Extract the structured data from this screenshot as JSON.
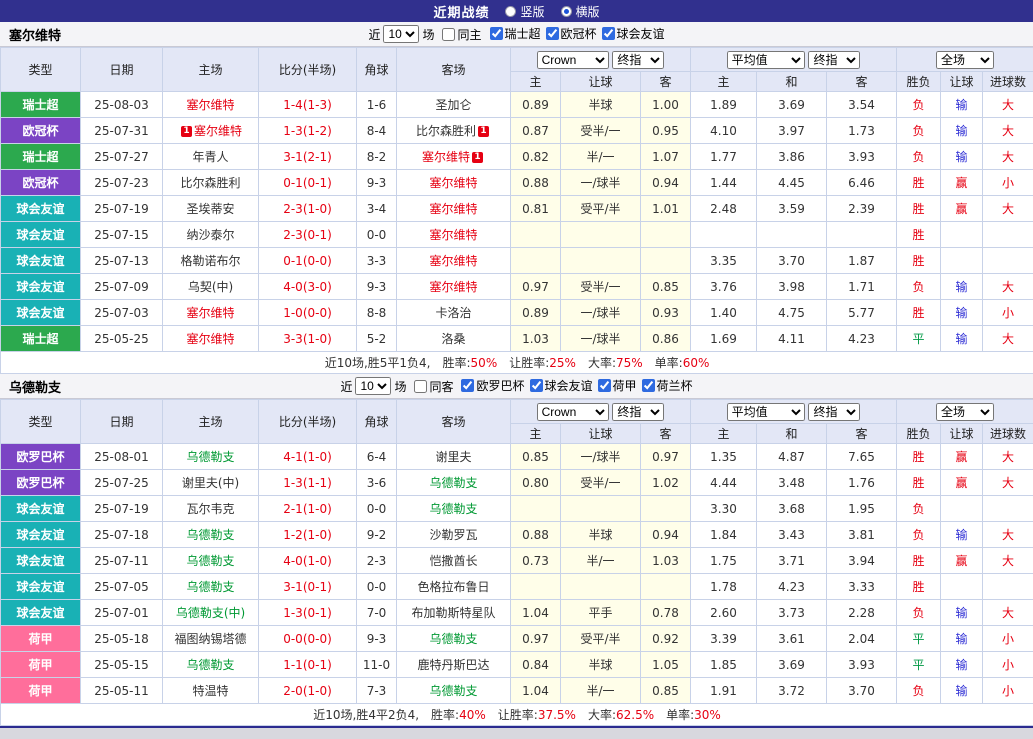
{
  "topbar": {
    "title": "近期战绩",
    "radio_vertical": "竖版",
    "radio_horizontal": "横版",
    "selected": "横版"
  },
  "header": {
    "col_type": "类型",
    "col_date": "日期",
    "col_home": "主场",
    "col_score": "比分(半场)",
    "col_corner": "角球",
    "col_away": "客场",
    "bookmaker_select": "Crown",
    "final_select": "终指",
    "avg_select": "平均值",
    "avg_final_select": "终指",
    "fullmatch_select": "全场",
    "sub_home": "主",
    "sub_handicap": "让球",
    "sub_away": "客",
    "sub_avg_home": "主",
    "sub_draw": "和",
    "sub_avg_away": "客",
    "sub_result": "胜负",
    "sub_result_handicap": "让球",
    "sub_goals": "进球数"
  },
  "filter_common": {
    "prefix": "近",
    "count": "10",
    "suffix": "场"
  },
  "colors": {
    "types": {
      "瑞士超": "#2CA94E",
      "欧冠杯": "#7B44C4",
      "球会友谊": "#19B1B5",
      "欧罗巴杯": "#7B44C4",
      "荷甲": "#FF6E9B"
    },
    "results": {
      "胜": "#E60012",
      "平": "#009944",
      "负": "#E60012",
      "赢": "#E60012",
      "输": "#2C2CD4",
      "大": "#E60012",
      "小": "#E60012"
    }
  },
  "sections": [
    {
      "team": "塞尔维特",
      "team_color": "#E60012",
      "filter": {
        "same_label": "同主",
        "same_checked": false,
        "leagues": [
          {
            "label": "瑞士超",
            "checked": true
          },
          {
            "label": "欧冠杯",
            "checked": true
          },
          {
            "label": "球会友谊",
            "checked": true
          }
        ]
      },
      "rows": [
        {
          "type": "瑞士超",
          "date": "25-08-03",
          "home": "塞尔维特",
          "home_focus": true,
          "score": "1-4(1-3)",
          "corner": "1-6",
          "away": "圣加仑",
          "odds": [
            "0.89",
            "半球",
            "1.00"
          ],
          "avg": [
            "1.89",
            "3.69",
            "3.54"
          ],
          "result": [
            "负",
            "输",
            "大"
          ]
        },
        {
          "type": "欧冠杯",
          "date": "25-07-31",
          "home": "塞尔维特",
          "home_focus": true,
          "home_card": "1",
          "score": "1-3(1-2)",
          "corner": "8-4",
          "away": "比尔森胜利",
          "away_card": "1",
          "odds": [
            "0.87",
            "受半/一",
            "0.95"
          ],
          "avg": [
            "4.10",
            "3.97",
            "1.73"
          ],
          "result": [
            "负",
            "输",
            "大"
          ]
        },
        {
          "type": "瑞士超",
          "date": "25-07-27",
          "home": "年青人",
          "score": "3-1(2-1)",
          "corner": "8-2",
          "away": "塞尔维特",
          "away_focus": true,
          "away_card": "1",
          "odds": [
            "0.82",
            "半/一",
            "1.07"
          ],
          "avg": [
            "1.77",
            "3.86",
            "3.93"
          ],
          "result": [
            "负",
            "输",
            "大"
          ]
        },
        {
          "type": "欧冠杯",
          "date": "25-07-23",
          "home": "比尔森胜利",
          "score": "0-1(0-1)",
          "corner": "9-3",
          "away": "塞尔维特",
          "away_focus": true,
          "odds": [
            "0.88",
            "一/球半",
            "0.94"
          ],
          "avg": [
            "1.44",
            "4.45",
            "6.46"
          ],
          "result": [
            "胜",
            "赢",
            "小"
          ]
        },
        {
          "type": "球会友谊",
          "date": "25-07-19",
          "home": "圣埃蒂安",
          "score": "2-3(1-0)",
          "corner": "3-4",
          "away": "塞尔维特",
          "away_focus": true,
          "odds": [
            "0.81",
            "受平/半",
            "1.01"
          ],
          "avg": [
            "2.48",
            "3.59",
            "2.39"
          ],
          "result": [
            "胜",
            "赢",
            "大"
          ]
        },
        {
          "type": "球会友谊",
          "date": "25-07-15",
          "home": "纳沙泰尔",
          "score": "2-3(0-1)",
          "corner": "0-0",
          "away": "塞尔维特",
          "away_focus": true,
          "odds": [
            "",
            "",
            ""
          ],
          "avg": [
            "",
            "",
            ""
          ],
          "result": [
            "胜",
            "",
            ""
          ]
        },
        {
          "type": "球会友谊",
          "date": "25-07-13",
          "home": "格勒诺布尔",
          "score": "0-1(0-0)",
          "corner": "3-3",
          "away": "塞尔维特",
          "away_focus": true,
          "odds": [
            "",
            "",
            ""
          ],
          "avg": [
            "3.35",
            "3.70",
            "1.87"
          ],
          "result": [
            "胜",
            "",
            ""
          ]
        },
        {
          "type": "球会友谊",
          "date": "25-07-09",
          "home": "乌契(中)",
          "score": "4-0(3-0)",
          "corner": "9-3",
          "away": "塞尔维特",
          "away_focus": true,
          "odds": [
            "0.97",
            "受半/一",
            "0.85"
          ],
          "avg": [
            "3.76",
            "3.98",
            "1.71"
          ],
          "result": [
            "负",
            "输",
            "大"
          ]
        },
        {
          "type": "球会友谊",
          "date": "25-07-03",
          "home": "塞尔维特",
          "home_focus": true,
          "score": "1-0(0-0)",
          "corner": "8-8",
          "away": "卡洛治",
          "odds": [
            "0.89",
            "一/球半",
            "0.93"
          ],
          "avg": [
            "1.40",
            "4.75",
            "5.77"
          ],
          "result": [
            "胜",
            "输",
            "小"
          ]
        },
        {
          "type": "瑞士超",
          "date": "25-05-25",
          "home": "塞尔维特",
          "home_focus": true,
          "score": "3-3(1-0)",
          "corner": "5-2",
          "away": "洛桑",
          "odds": [
            "1.03",
            "一/球半",
            "0.86"
          ],
          "avg": [
            "1.69",
            "4.11",
            "4.23"
          ],
          "result": [
            "平",
            "输",
            "大"
          ]
        }
      ],
      "summary": {
        "prefix": "近10场,胜5平1负4,",
        "stats": [
          {
            "label": "胜率:",
            "value": "50%"
          },
          {
            "label": "让胜率:",
            "value": "25%"
          },
          {
            "label": "大率:",
            "value": "75%"
          },
          {
            "label": "单率:",
            "value": "60%"
          }
        ]
      }
    },
    {
      "team": "乌德勒支",
      "team_color": "#009933",
      "filter": {
        "same_label": "同客",
        "same_checked": false,
        "leagues": [
          {
            "label": "欧罗巴杯",
            "checked": true
          },
          {
            "label": "球会友谊",
            "checked": true
          },
          {
            "label": "荷甲",
            "checked": true
          },
          {
            "label": "荷兰杯",
            "checked": true
          }
        ]
      },
      "rows": [
        {
          "type": "欧罗巴杯",
          "date": "25-08-01",
          "home": "乌德勒支",
          "home_focus": true,
          "score": "4-1(1-0)",
          "corner": "6-4",
          "away": "谢里夫",
          "odds": [
            "0.85",
            "一/球半",
            "0.97"
          ],
          "avg": [
            "1.35",
            "4.87",
            "7.65"
          ],
          "result": [
            "胜",
            "赢",
            "大"
          ]
        },
        {
          "type": "欧罗巴杯",
          "date": "25-07-25",
          "home": "谢里夫(中)",
          "score": "1-3(1-1)",
          "corner": "3-6",
          "away": "乌德勒支",
          "away_focus": true,
          "odds": [
            "0.80",
            "受半/一",
            "1.02"
          ],
          "avg": [
            "4.44",
            "3.48",
            "1.76"
          ],
          "result": [
            "胜",
            "赢",
            "大"
          ]
        },
        {
          "type": "球会友谊",
          "date": "25-07-19",
          "home": "瓦尔韦克",
          "score": "2-1(1-0)",
          "corner": "0-0",
          "away": "乌德勒支",
          "away_focus": true,
          "odds": [
            "",
            "",
            ""
          ],
          "avg": [
            "3.30",
            "3.68",
            "1.95"
          ],
          "result": [
            "负",
            "",
            ""
          ]
        },
        {
          "type": "球会友谊",
          "date": "25-07-18",
          "home": "乌德勒支",
          "home_focus": true,
          "score": "1-2(1-0)",
          "corner": "9-2",
          "away": "沙勒罗瓦",
          "odds": [
            "0.88",
            "半球",
            "0.94"
          ],
          "avg": [
            "1.84",
            "3.43",
            "3.81"
          ],
          "result": [
            "负",
            "输",
            "大"
          ]
        },
        {
          "type": "球会友谊",
          "date": "25-07-11",
          "home": "乌德勒支",
          "home_focus": true,
          "score": "4-0(1-0)",
          "corner": "2-3",
          "away": "恺撒酋长",
          "odds": [
            "0.73",
            "半/一",
            "1.03"
          ],
          "avg": [
            "1.75",
            "3.71",
            "3.94"
          ],
          "result": [
            "胜",
            "赢",
            "大"
          ]
        },
        {
          "type": "球会友谊",
          "date": "25-07-05",
          "home": "乌德勒支",
          "home_focus": true,
          "score": "3-1(0-1)",
          "corner": "0-0",
          "away": "色格拉布鲁日",
          "odds": [
            "",
            "",
            ""
          ],
          "avg": [
            "1.78",
            "4.23",
            "3.33"
          ],
          "result": [
            "胜",
            "",
            ""
          ]
        },
        {
          "type": "球会友谊",
          "date": "25-07-01",
          "home": "乌德勒支(中)",
          "home_focus": true,
          "score": "1-3(0-1)",
          "corner": "7-0",
          "away": "布加勒斯特星队",
          "odds": [
            "1.04",
            "平手",
            "0.78"
          ],
          "avg": [
            "2.60",
            "3.73",
            "2.28"
          ],
          "result": [
            "负",
            "输",
            "大"
          ]
        },
        {
          "type": "荷甲",
          "date": "25-05-18",
          "home": "福图纳锡塔德",
          "score": "0-0(0-0)",
          "corner": "9-3",
          "away": "乌德勒支",
          "away_focus": true,
          "odds": [
            "0.97",
            "受平/半",
            "0.92"
          ],
          "avg": [
            "3.39",
            "3.61",
            "2.04"
          ],
          "result": [
            "平",
            "输",
            "小"
          ]
        },
        {
          "type": "荷甲",
          "date": "25-05-15",
          "home": "乌德勒支",
          "home_focus": true,
          "score": "1-1(0-1)",
          "corner": "11-0",
          "away": "鹿特丹斯巴达",
          "odds": [
            "0.84",
            "半球",
            "1.05"
          ],
          "avg": [
            "1.85",
            "3.69",
            "3.93"
          ],
          "result": [
            "平",
            "输",
            "小"
          ]
        },
        {
          "type": "荷甲",
          "date": "25-05-11",
          "home": "特温特",
          "score": "2-0(1-0)",
          "corner": "7-3",
          "away": "乌德勒支",
          "away_focus": true,
          "odds": [
            "1.04",
            "半/一",
            "0.85"
          ],
          "avg": [
            "1.91",
            "3.72",
            "3.70"
          ],
          "result": [
            "负",
            "输",
            "小"
          ]
        }
      ],
      "summary": {
        "prefix": "近10场,胜4平2负4,",
        "stats": [
          {
            "label": "胜率:",
            "value": "40%"
          },
          {
            "label": "让胜率:",
            "value": "37.5%"
          },
          {
            "label": "大率:",
            "value": "62.5%"
          },
          {
            "label": "单率:",
            "value": "30%"
          }
        ]
      }
    }
  ]
}
